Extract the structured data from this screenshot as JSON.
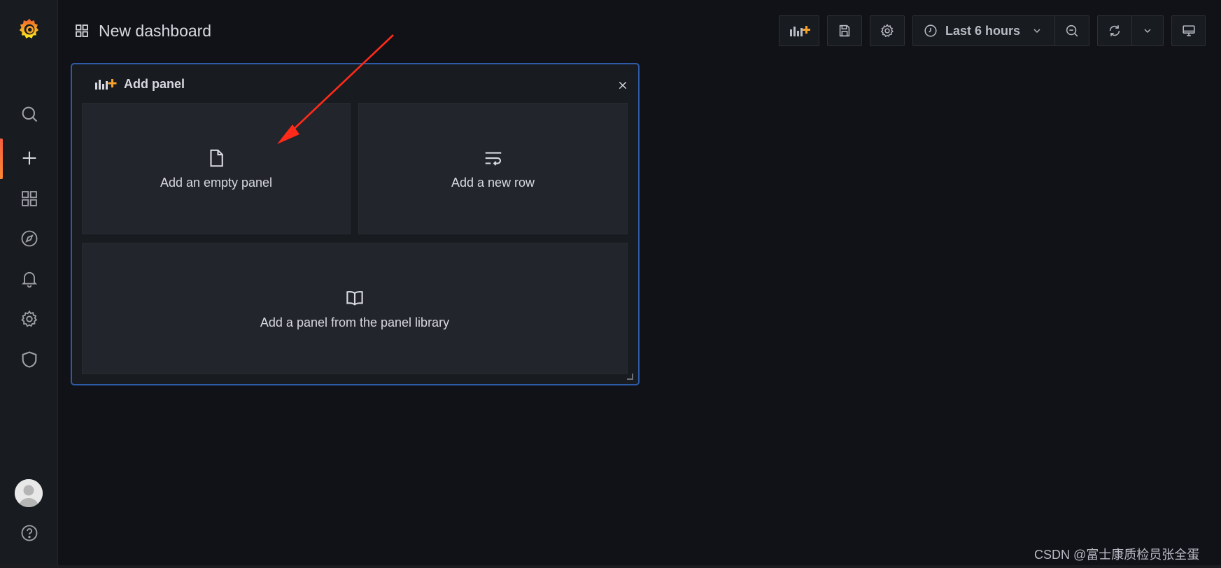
{
  "topbar": {
    "title": "New dashboard",
    "time_range": "Last 6 hours"
  },
  "sidebar": {
    "items": [
      {
        "name": "search",
        "icon": "search-icon"
      },
      {
        "name": "create",
        "icon": "plus-icon"
      },
      {
        "name": "dashboards",
        "icon": "apps-icon"
      },
      {
        "name": "explore",
        "icon": "compass-icon"
      },
      {
        "name": "alerting",
        "icon": "bell-icon"
      },
      {
        "name": "configuration",
        "icon": "gear-icon"
      },
      {
        "name": "server-admin",
        "icon": "shield-icon"
      },
      {
        "name": "profile",
        "icon": "avatar"
      },
      {
        "name": "help",
        "icon": "question-circle-icon"
      }
    ]
  },
  "add_panel": {
    "title": "Add panel",
    "options": {
      "empty_panel": "Add an empty panel",
      "new_row": "Add a new row",
      "library": "Add a panel from the panel library"
    }
  },
  "colors": {
    "background": "#111217",
    "sidebar": "#181b1f",
    "accent_orange": "#ff8833",
    "panel_border": "#2d5ba8",
    "annotation_arrow": "#ff2a1a"
  },
  "watermark": "CSDN @富士康质检员张全蛋"
}
